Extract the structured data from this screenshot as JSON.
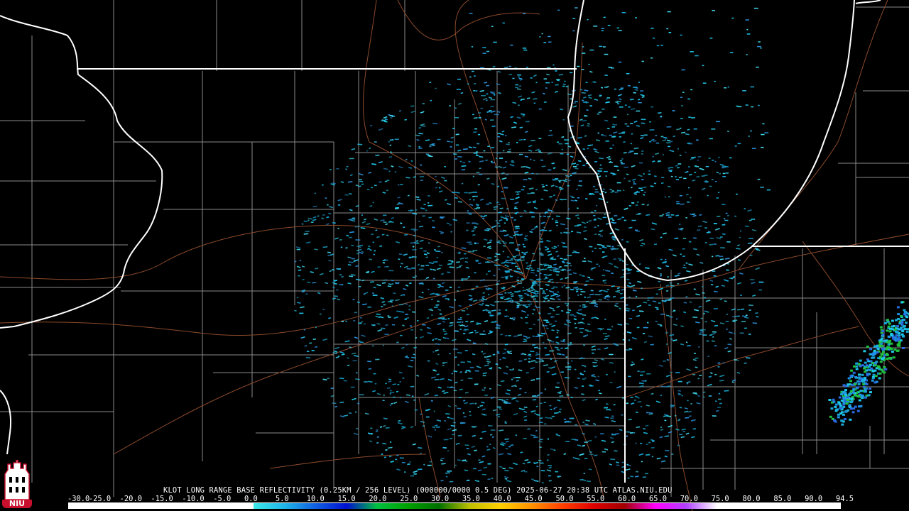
{
  "product": {
    "caption": "KLOT LONG RANGE BASE REFLECTIVITY (0.25KM / 256 LEVEL) (000000/0000 0.5 DEG) 2025-06-27 20:38 UTC  ATLAS.NIU.EDU"
  },
  "logo": {
    "text": "NIU",
    "color": "#c8102e"
  },
  "colors": {
    "background": "#000000",
    "state_border": "#ffffff",
    "county_border": "#8a8a8a",
    "road": "#8b4a2b"
  },
  "scale": {
    "labels": [
      "-30.0",
      "-25.0",
      "-20.0",
      "-15.0",
      "-10.0",
      "-5.0",
      "0.0",
      "5.0",
      "10.0",
      "15.0",
      "20.0",
      "25.0",
      "30.0",
      "35.0",
      "40.0",
      "45.0",
      "50.0",
      "55.0",
      "60.0",
      "65.0",
      "70.0",
      "75.0",
      "80.0",
      "85.0",
      "90.0",
      "94.5"
    ],
    "colors": [
      "#ffffff",
      "#ffffff",
      "#ffffff",
      "#ffffff",
      "#ffffff",
      "#ffffff",
      "#3ce8e8",
      "#20b4e8",
      "#1060e0",
      "#0010d0",
      "#00c040",
      "#00a000",
      "#007000",
      "#c0c000",
      "#ffd000",
      "#ff9000",
      "#ff4000",
      "#e00000",
      "#a00000",
      "#ff00ff",
      "#b040ff",
      "#ffffff",
      "#ffffff",
      "#ffffff",
      "#ffffff"
    ]
  },
  "echo_colors": [
    "#1ec8e8",
    "#28b8e0",
    "#16a8d8",
    "#2a90d8",
    "#3fd8ec"
  ]
}
